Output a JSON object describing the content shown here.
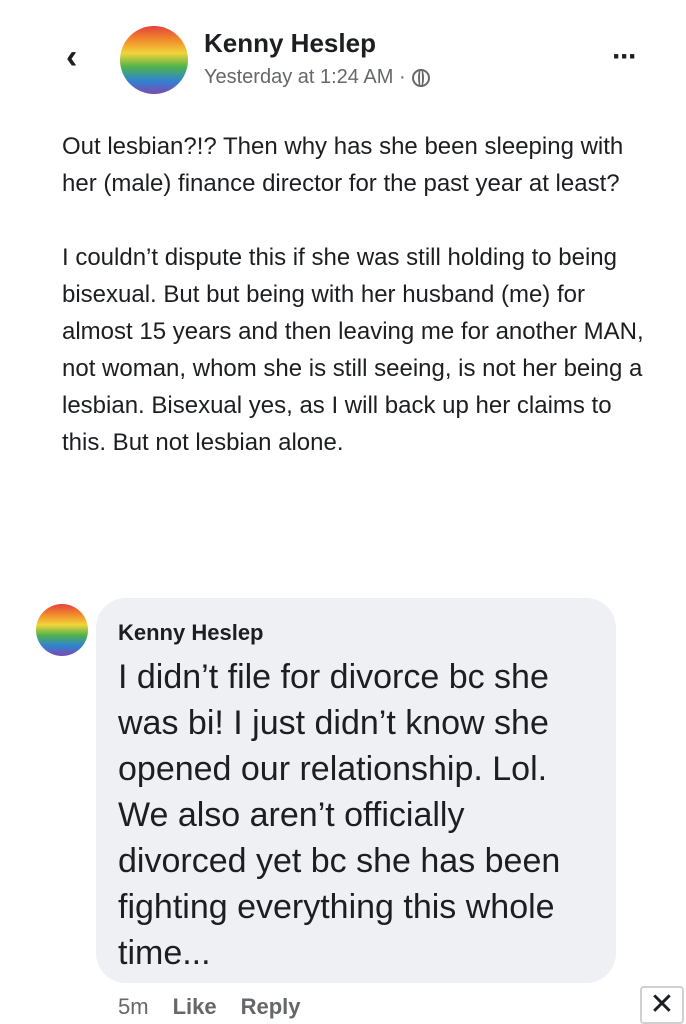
{
  "header": {
    "author": "Kenny Heslep",
    "timestamp": "Yesterday at 1:24 AM ·",
    "back_icon": "‹",
    "more_icon": "···"
  },
  "post": {
    "paragraph_1": "Out lesbian?!? Then why has she been sleeping with her (male) finance director for the past year at least?",
    "paragraph_2": "I couldn’t dispute this if she was still holding to being bisexual. But but being with her husband (me) for almost 15 years and then leaving me for another MAN, not woman, whom she is still seeing, is not her being a lesbian. Bisexual yes, as I will back up her claims to this. But not lesbian alone."
  },
  "comment": {
    "author": "Kenny Heslep",
    "text": "I didn’t file for divorce bc she was bi! I just didn’t know she opened our relationship. Lol. We also aren’t officially divorced yet bc she has been fighting everything this whole time...",
    "time": "5m",
    "like_label": "Like",
    "reply_label": "Reply"
  },
  "close_icon": "✕"
}
